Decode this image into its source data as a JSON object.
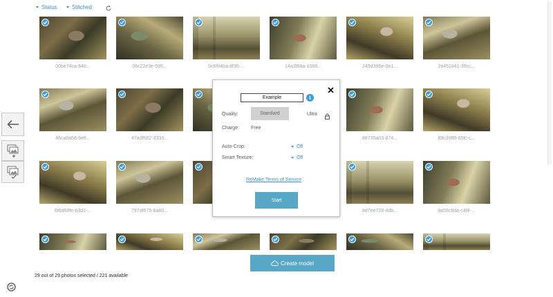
{
  "filters": {
    "status_label": "Status",
    "stitched_label": "Stitched"
  },
  "photos": [
    {
      "caption": "00be74ca-64b..."
    },
    {
      "caption": "06c22e3e-595..."
    },
    {
      "caption": "0c66f4ba-8f95-..."
    },
    {
      "caption": "14a3f68a-1089..."
    },
    {
      "caption": "249d395e-0e1..."
    },
    {
      "caption": "2e451841-39cc..."
    },
    {
      "caption": "46ca0a58-6e6..."
    },
    {
      "caption": "47a3f562-3333..."
    },
    {
      "caption": ""
    },
    {
      "caption": ""
    },
    {
      "caption": "88735a03-874..."
    },
    {
      "caption": "89c39ff0-65fc-c..."
    },
    {
      "caption": "6f6d68fe-b3d1-..."
    },
    {
      "caption": "797df675-6a80..."
    },
    {
      "caption": "82..."
    },
    {
      "caption": ""
    },
    {
      "caption": "8d7ee728-4db..."
    },
    {
      "caption": "9a59c8da-c4f8-..."
    },
    {
      "caption": ""
    },
    {
      "caption": ""
    },
    {
      "caption": ""
    },
    {
      "caption": ""
    },
    {
      "caption": ""
    },
    {
      "caption": ""
    }
  ],
  "modal": {
    "model_name": "Example",
    "quality_label": "Quality:",
    "quality_standard": "Standard",
    "quality_ultra": "Ultra",
    "charge_label": "Charge:",
    "charge_value": "Free",
    "autocrop_label": "Auto-Crop:",
    "autocrop_value": "Off",
    "smarttexture_label": "Smart Texture:",
    "smarttexture_value": "Off",
    "tos_link": "ReMake Terms of Service",
    "start_label": "Start"
  },
  "create_model_label": "Create model",
  "status_text": "29 out of 29 photos selected / 221 available",
  "colors": {
    "accent": "#3d9ddc",
    "button": "#58a7c7",
    "link": "#3d8fd6"
  },
  "icons": [
    "back-arrow-icon",
    "add-photos-icon",
    "select-photos-icon",
    "refresh-icon",
    "cloud-upload-icon",
    "info-icon",
    "close-icon",
    "lock-icon",
    "sync-icon"
  ]
}
